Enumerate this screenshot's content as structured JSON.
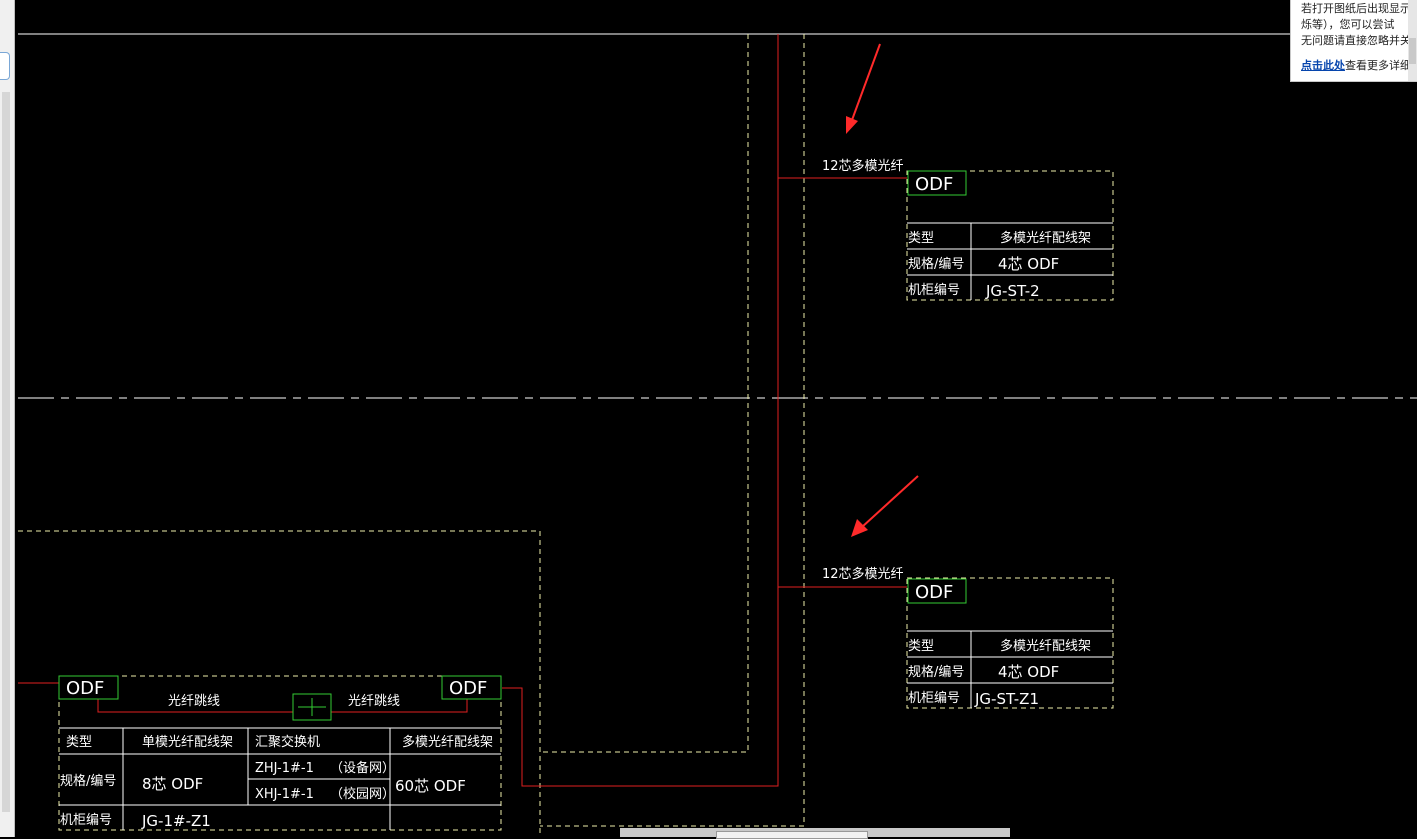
{
  "notice": {
    "line1": "若打开图纸后出现显示",
    "line2": "烁等），您可以尝试",
    "line3": "无问题请直接忽略并关",
    "link": "点击此处",
    "line4_rest": "查看更多详细"
  },
  "drawing": {
    "cable_label": "12芯多模光纤",
    "odf_label": "ODF",
    "patch_label": "光纤跳线",
    "row_labels": {
      "type": "类型",
      "spec": "规格/编号",
      "cabinet": "机柜编号"
    },
    "cabinet_top": {
      "type_value": "多模光纤配线架",
      "spec_value": "4芯 ODF",
      "cabinet_value": "JG-ST-2"
    },
    "cabinet_mid": {
      "type_value": "多模光纤配线架",
      "spec_value": "4芯 ODF",
      "cabinet_value": "JG-ST-Z1"
    },
    "main_table": {
      "col1_type": "单模光纤配线架",
      "col2_type": "汇聚交换机",
      "col3_type": "多模光纤配线架",
      "col1_spec": "8芯 ODF",
      "switch1": "ZHJ-1#-1",
      "switch1_net": "（设备网）",
      "switch2": "XHJ-1#-1",
      "switch2_net": "（校园网）",
      "col3_spec": "60芯 ODF",
      "cabinet_value": "JG-1#-Z1"
    }
  },
  "colors": {
    "background": "#000000",
    "line": "#ffffff",
    "red": "#e02020",
    "green": "#33cc33",
    "dashed": "#eeeeaa",
    "arrow": "#ff2a2a"
  }
}
